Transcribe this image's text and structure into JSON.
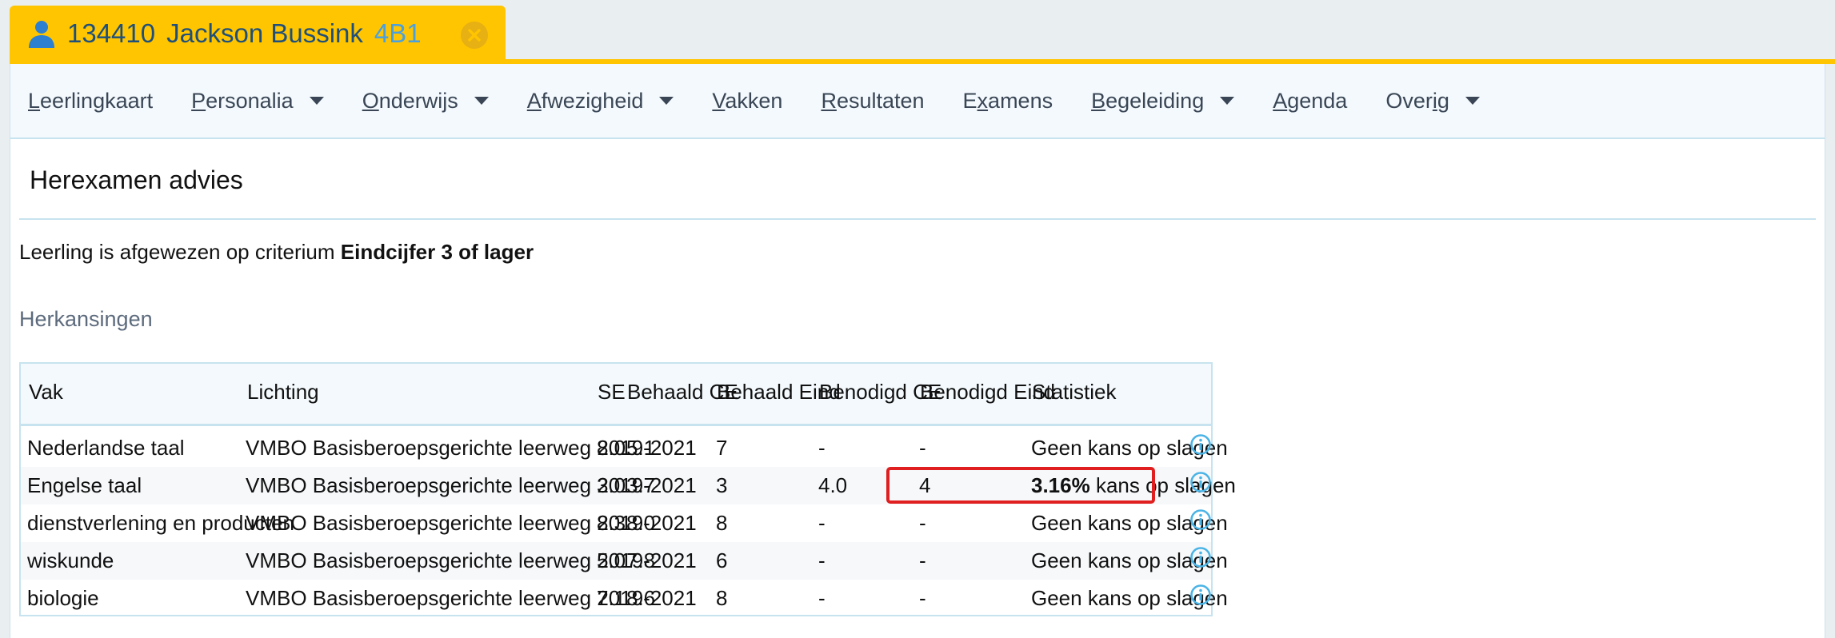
{
  "student": {
    "number": "134410",
    "name": "Jackson Bussink",
    "class": "4B1",
    "person_icon": "person-icon",
    "close_icon": "close-icon"
  },
  "nav": [
    {
      "first": "L",
      "rest": "eerlingkaart",
      "dropdown": false
    },
    {
      "first": "P",
      "rest": "ersonalia",
      "dropdown": true
    },
    {
      "first": "O",
      "rest": "nderwijs",
      "dropdown": true
    },
    {
      "first": "A",
      "rest": "fwezigheid",
      "dropdown": true
    },
    {
      "first": "V",
      "rest": "akken",
      "dropdown": false
    },
    {
      "first": "R",
      "rest": "esultaten",
      "dropdown": false
    },
    {
      "pre": "E",
      "first": "x",
      "rest": "amens",
      "dropdown": false
    },
    {
      "first": "B",
      "rest": "egeleiding",
      "dropdown": true
    },
    {
      "first": "A",
      "rest": "genda",
      "dropdown": false
    },
    {
      "pre": "Over",
      "first": "i",
      "rest": "g",
      "dropdown": true
    }
  ],
  "page": {
    "title": "Herexamen advies",
    "criterium_prefix": "Leerling is afgewezen op criterium",
    "criterium_value": "Eindcijfer 3 of lager",
    "section_title": "Herkansingen"
  },
  "table": {
    "headers": [
      "Vak",
      "Lichting",
      "SE",
      "Behaald CE",
      "Behaald Eind",
      "Benodigd CE",
      "Benodigd Eind",
      "Statistiek"
    ],
    "rows": [
      {
        "vak": "Nederlandse taal",
        "lichting": "VMBO Basisberoepsgerichte leerweg 2019-2021",
        "se": "8.0",
        "behaald_ce": "5.1",
        "behaald_eind": "7",
        "benodigd_ce": "-",
        "benodigd_eind": "-",
        "stat_bold": "",
        "stat_text": "Geen kans op slagen"
      },
      {
        "vak": "Engelse taal",
        "lichting": "VMBO Basisberoepsgerichte leerweg 2019-2021",
        "se": "3.0",
        "behaald_ce": "3.7",
        "behaald_eind": "3",
        "benodigd_ce": "4.0",
        "benodigd_eind": "4",
        "stat_bold": "3.16%",
        "stat_text": " kans op slagen"
      },
      {
        "vak": "dienstverlening en producten",
        "lichting": "VMBO Basisberoepsgerichte leerweg 2019-2021",
        "se": "8.3",
        "behaald_ce": "8.0",
        "behaald_eind": "8",
        "benodigd_ce": "-",
        "benodigd_eind": "-",
        "stat_bold": "",
        "stat_text": "Geen kans op slagen"
      },
      {
        "vak": "wiskunde",
        "lichting": "VMBO Basisberoepsgerichte leerweg 2019-2021",
        "se": "5.0",
        "behaald_ce": "7.8",
        "behaald_eind": "6",
        "benodigd_ce": "-",
        "benodigd_eind": "-",
        "stat_bold": "",
        "stat_text": "Geen kans op slagen"
      },
      {
        "vak": "biologie",
        "lichting": "VMBO Basisberoepsgerichte leerweg 2019-2021",
        "se": "7.1",
        "behaald_ce": "8.6",
        "behaald_eind": "8",
        "benodigd_ce": "-",
        "benodigd_eind": "-",
        "stat_bold": "",
        "stat_text": "Geen kans op slagen"
      }
    ]
  },
  "colors": {
    "tab": "#ffc500",
    "nav_bg": "#f3f9fc",
    "highlight": "#e02020",
    "info": "#4bb4e6"
  }
}
